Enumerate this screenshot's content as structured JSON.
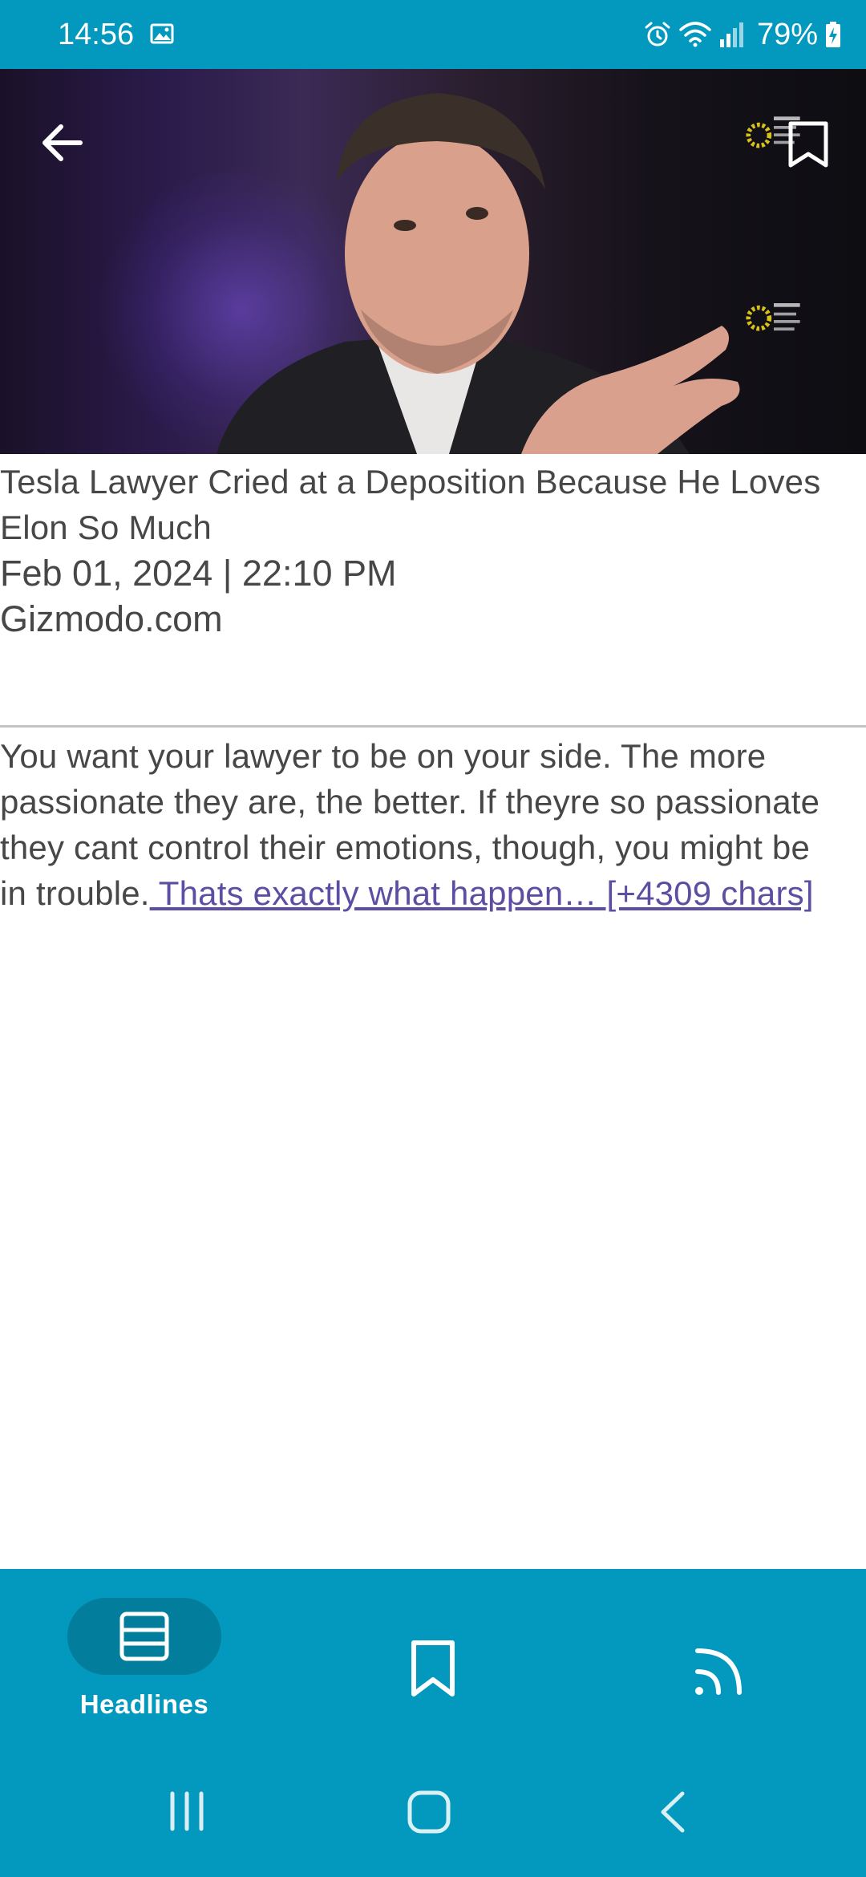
{
  "status_bar": {
    "time": "14:56",
    "battery": "79%",
    "icons": [
      "gallery-icon",
      "alarm-icon",
      "wifi-icon",
      "signal-icon",
      "battery-charging-icon"
    ]
  },
  "header": {
    "back_icon": "arrow-left-icon",
    "bookmark_icon": "bookmark-icon"
  },
  "article": {
    "title": "Tesla Lawyer Cried at a Deposition Because He Loves Elon So Much",
    "date": "Feb 01, 2024 | 22:10 PM",
    "source": "Gizmodo.com",
    "body": "You want your lawyer to be on your side. The more passionate they are, the better. If theyre so passionate they cant control their emotions, though, you might be in trouble.",
    "link_text": " Thats exactly what happen… [+4309 chars]"
  },
  "bottom_nav": {
    "items": [
      {
        "label": "Headlines",
        "icon": "headlines-icon",
        "active": true
      },
      {
        "label": "",
        "icon": "bookmark-icon",
        "active": false
      },
      {
        "label": "",
        "icon": "feed-icon",
        "active": false
      }
    ]
  },
  "system_nav": {
    "icons": [
      "recents-icon",
      "home-icon",
      "back-icon"
    ]
  },
  "colors": {
    "primary": "#0399be",
    "active_pill": "#037d9c",
    "text": "#474747",
    "link": "#5e4ea3"
  }
}
